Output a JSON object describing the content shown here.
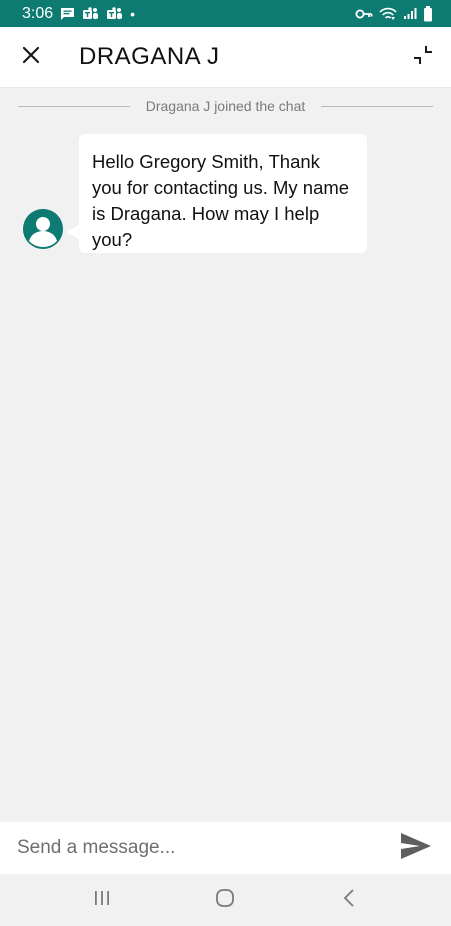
{
  "status_bar": {
    "time": "3:06",
    "dot": "•",
    "left_icons": [
      "message-notification-icon",
      "teams-icon",
      "teams-icon"
    ],
    "right_icons": [
      "vpn-key-icon",
      "wifi-icon",
      "signal-icon",
      "battery-icon"
    ],
    "background_color": "#0e7b73"
  },
  "header": {
    "title": "DRAGANA J",
    "close_icon": "close-icon",
    "minimize_icon": "minimize-icon"
  },
  "system_message": "Dragana J joined the chat",
  "messages": [
    {
      "sender_avatar": "person-avatar-icon",
      "text": "Hello Gregory Smith, Thank you for contacting us. My name is Dragana. How may I help you?"
    }
  ],
  "composer": {
    "placeholder": "Send a message...",
    "value": "",
    "send_icon": "send-icon"
  },
  "nav_bar": {
    "buttons": [
      "recent-apps-icon",
      "home-icon",
      "back-icon"
    ]
  },
  "colors": {
    "accent": "#0e7b73",
    "background": "#f1f1f1",
    "bubble": "#ffffff"
  }
}
